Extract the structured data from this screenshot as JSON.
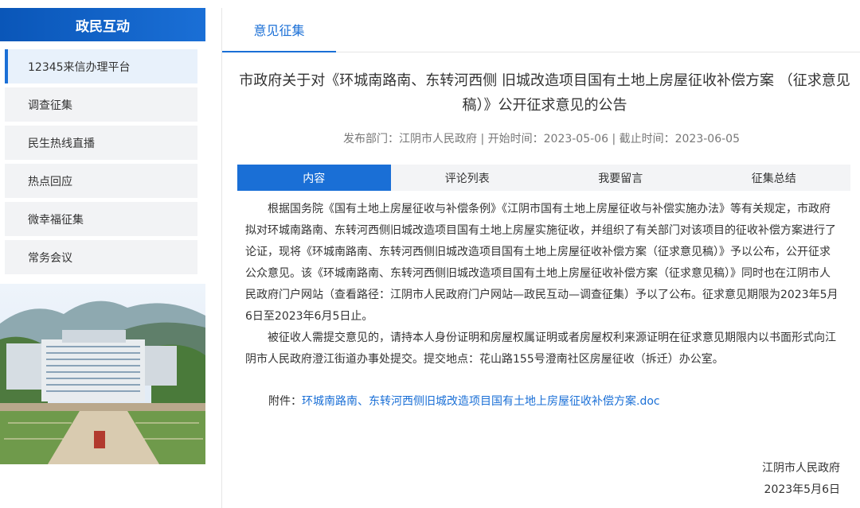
{
  "sidebar": {
    "title": "政民互动",
    "items": [
      {
        "label": "12345来信办理平台",
        "active": true
      },
      {
        "label": "调查征集",
        "active": false
      },
      {
        "label": "民生热线直播",
        "active": false
      },
      {
        "label": "热点回应",
        "active": false
      },
      {
        "label": "微幸福征集",
        "active": false
      },
      {
        "label": "常务会议",
        "active": false
      }
    ]
  },
  "main": {
    "tab_label": "意见征集",
    "title": "市政府关于对《环城南路南、东转河西侧 旧城改造项目国有土地上房屋征收补偿方案 （征求意见稿）》公开征求意见的公告",
    "meta": "发布部门：江阴市人民政府 | 开始时间：2023-05-06 | 截止时间：2023-06-05",
    "sub_tabs": [
      {
        "label": "内容",
        "active": true
      },
      {
        "label": "评论列表",
        "active": false
      },
      {
        "label": "我要留言",
        "active": false
      },
      {
        "label": "征集总结",
        "active": false
      }
    ],
    "paragraphs": [
      "根据国务院《国有土地上房屋征收与补偿条例》《江阴市国有土地上房屋征收与补偿实施办法》等有关规定，市政府拟对环城南路南、东转河西侧旧城改造项目国有土地上房屋实施征收，并组织了有关部门对该项目的征收补偿方案进行了论证，现将《环城南路南、东转河西侧旧城改造项目国有土地上房屋征收补偿方案（征求意见稿）》予以公布，公开征求公众意见。该《环城南路南、东转河西侧旧城改造项目国有土地上房屋征收补偿方案（征求意见稿）》同时也在江阴市人民政府门户网站（查看路径：江阴市人民政府门户网站—政民互动—调查征集）予以了公布。征求意见期限为2023年5月6日至2023年6月5日止。",
      "被征收人需提交意见的，请持本人身份证明和房屋权属证明或者房屋权利来源证明在征求意见期限内以书面形式向江阴市人民政府澄江街道办事处提交。提交地点：花山路155号澄南社区房屋征收（拆迁）办公室。"
    ],
    "attachment_label": "附件：",
    "attachment_link": "环城南路南、东转河西侧旧城改造项目国有土地上房屋征收补偿方案.doc",
    "signature_org": "江阴市人民政府",
    "signature_date": "2023年5月6日"
  },
  "colors": {
    "accent": "#1a6fd6",
    "header_bg": "#0a56b8"
  }
}
